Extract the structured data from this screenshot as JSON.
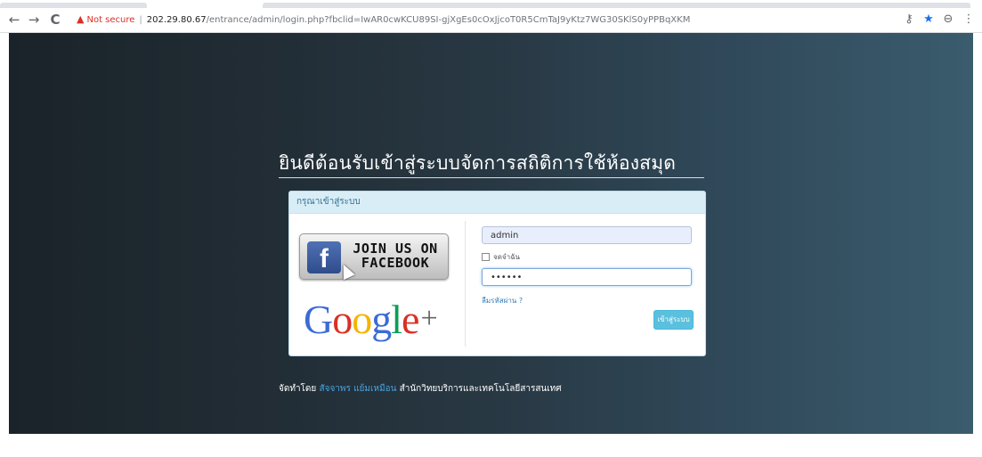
{
  "browser": {
    "back_icon": "←",
    "forward_icon": "→",
    "reload_icon": "C",
    "security_warning": "Not secure",
    "url_host": "202.29.80.67",
    "url_path": "/entrance/admin/login.php?fbclid=IwAR0cwKCU89SI-gjXgEs0cOxJjcoT0R5CmTaJ9yKtz7WG30SKlS0yPPBqXKM",
    "key_icon": "⚷",
    "star_icon": "★",
    "profile_icon": "⊖",
    "menu_icon": "⋮"
  },
  "page": {
    "title": "ยินดีต้อนรับเข้าสู่ระบบจัดการสถิติการใช้ห้องสมุด",
    "panel_heading": "กรุณาเข้าสู่ระบบ",
    "facebook_button": {
      "logo": "f",
      "line1": "JOIN US ON",
      "line2": "FACEBOOK"
    },
    "google_logo": {
      "letters": [
        "G",
        "o",
        "o",
        "g",
        "l",
        "e"
      ],
      "colors": [
        "#3b6bd6",
        "#d93025",
        "#f4b400",
        "#3b6bd6",
        "#0f9d58",
        "#d93025"
      ],
      "plus": "+"
    },
    "username_value": "admin",
    "remember_label": "จดจำฉัน",
    "password_value": "••••••",
    "forgot_link": "ลืมรหัสผ่าน ?",
    "login_button": "เข้าสู่ระบบ",
    "footer": {
      "prefix": "จัดทำโดย",
      "author": "สัจจาพร แย้มเหมือน",
      "org": "สำนักวิทยบริการและเทคโนโลยีสารสนเทศ"
    }
  },
  "colors": {
    "info_button": "#5bc0de",
    "panel_header_bg": "#d9edf7",
    "link": "#337ab7",
    "footer_author": "#4aa3df",
    "warning": "#d93025"
  }
}
